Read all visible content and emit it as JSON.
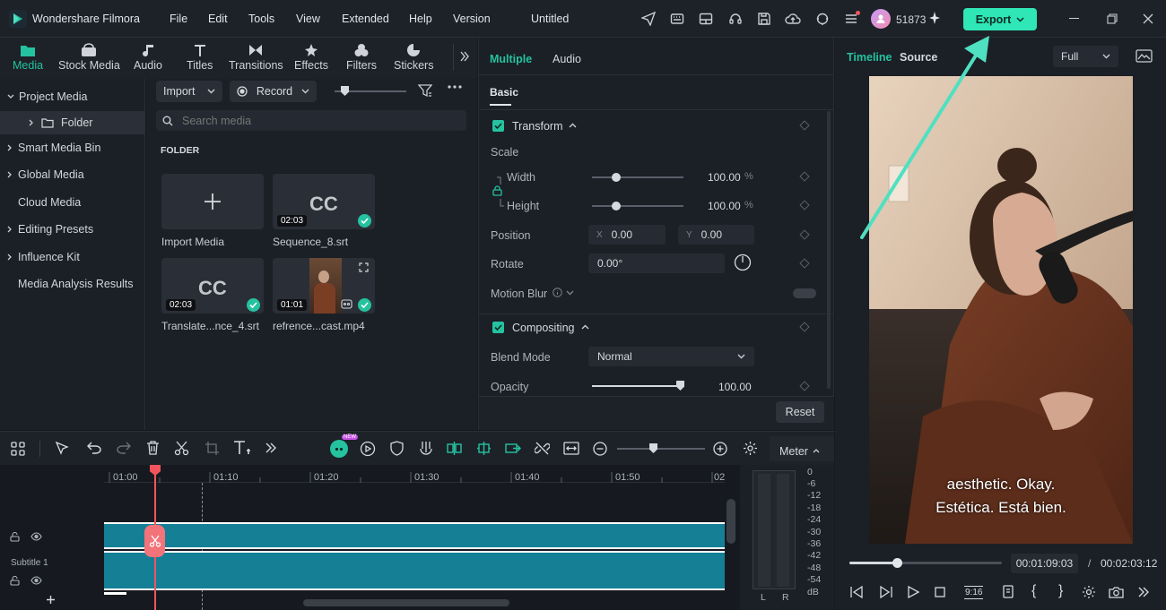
{
  "app": {
    "name": "Wondershare Filmora",
    "project_title": "Untitled"
  },
  "menu": [
    "File",
    "Edit",
    "Tools",
    "View",
    "Extended",
    "Help",
    "Version"
  ],
  "account": {
    "credits": "51873"
  },
  "export": {
    "label": "Export"
  },
  "media_tabs": [
    "Media",
    "Stock Media",
    "Audio",
    "Titles",
    "Transitions",
    "Effects",
    "Filters",
    "Stickers"
  ],
  "sidebar": {
    "items": [
      "Project Media",
      "Folder",
      "Smart Media Bin",
      "Global Media",
      "Cloud Media",
      "Editing Presets",
      "Influence Kit",
      "Media Analysis Results"
    ]
  },
  "library": {
    "import_label": "Import",
    "record_label": "Record",
    "search_placeholder": "Search media",
    "section": "FOLDER",
    "items": [
      {
        "name": "Import Media",
        "duration": ""
      },
      {
        "name": "Sequence_8.srt",
        "duration": "02:03"
      },
      {
        "name": "Translate...nce_4.srt",
        "duration": "02:03"
      },
      {
        "name": "refrence...cast.mp4",
        "duration": "01:01"
      }
    ],
    "cc_label": "CC"
  },
  "props": {
    "tabs": [
      "Multiple",
      "Audio"
    ],
    "subtab": "Basic",
    "transform": "Transform",
    "scale": "Scale",
    "width_label": "Width",
    "width_value": "100.00",
    "height_label": "Height",
    "height_value": "100.00",
    "pct": "%",
    "position": "Position",
    "pos_x_label": "X",
    "pos_x": "0.00",
    "pos_y_label": "Y",
    "pos_y": "0.00",
    "rotate": "Rotate",
    "rotate_value": "0.00°",
    "motion_blur": "Motion Blur",
    "compositing": "Compositing",
    "blend_mode": "Blend Mode",
    "blend_value": "Normal",
    "opacity": "Opacity",
    "opacity_value": "100.00",
    "reset": "Reset"
  },
  "preview": {
    "tabs": [
      "Timeline",
      "Source"
    ],
    "quality": "Full",
    "subtitle_line1": "aesthetic. Okay.",
    "subtitle_line2": "Estética. Está bien.",
    "current_time": "00:01:09:03",
    "separator": "/",
    "total_time": "00:02:03:12",
    "aspect_label": "9:16",
    "progress": 0.31
  },
  "timeline": {
    "ruler": [
      "01:00",
      "01:10",
      "01:20",
      "01:30",
      "01:40",
      "01:50",
      "02"
    ],
    "track_label": "Subtitle 1",
    "meter_label": "Meter",
    "meter_scale": [
      "0",
      "-6",
      "-12",
      "-18",
      "-24",
      "-30",
      "-36",
      "-42",
      "-48",
      "-54",
      "dB"
    ],
    "meter_l": "L",
    "meter_r": "R",
    "new_badge": "NEW"
  },
  "colors": {
    "accent": "#25c2a0",
    "playhead": "#f2545b",
    "clip": "#157f96"
  }
}
